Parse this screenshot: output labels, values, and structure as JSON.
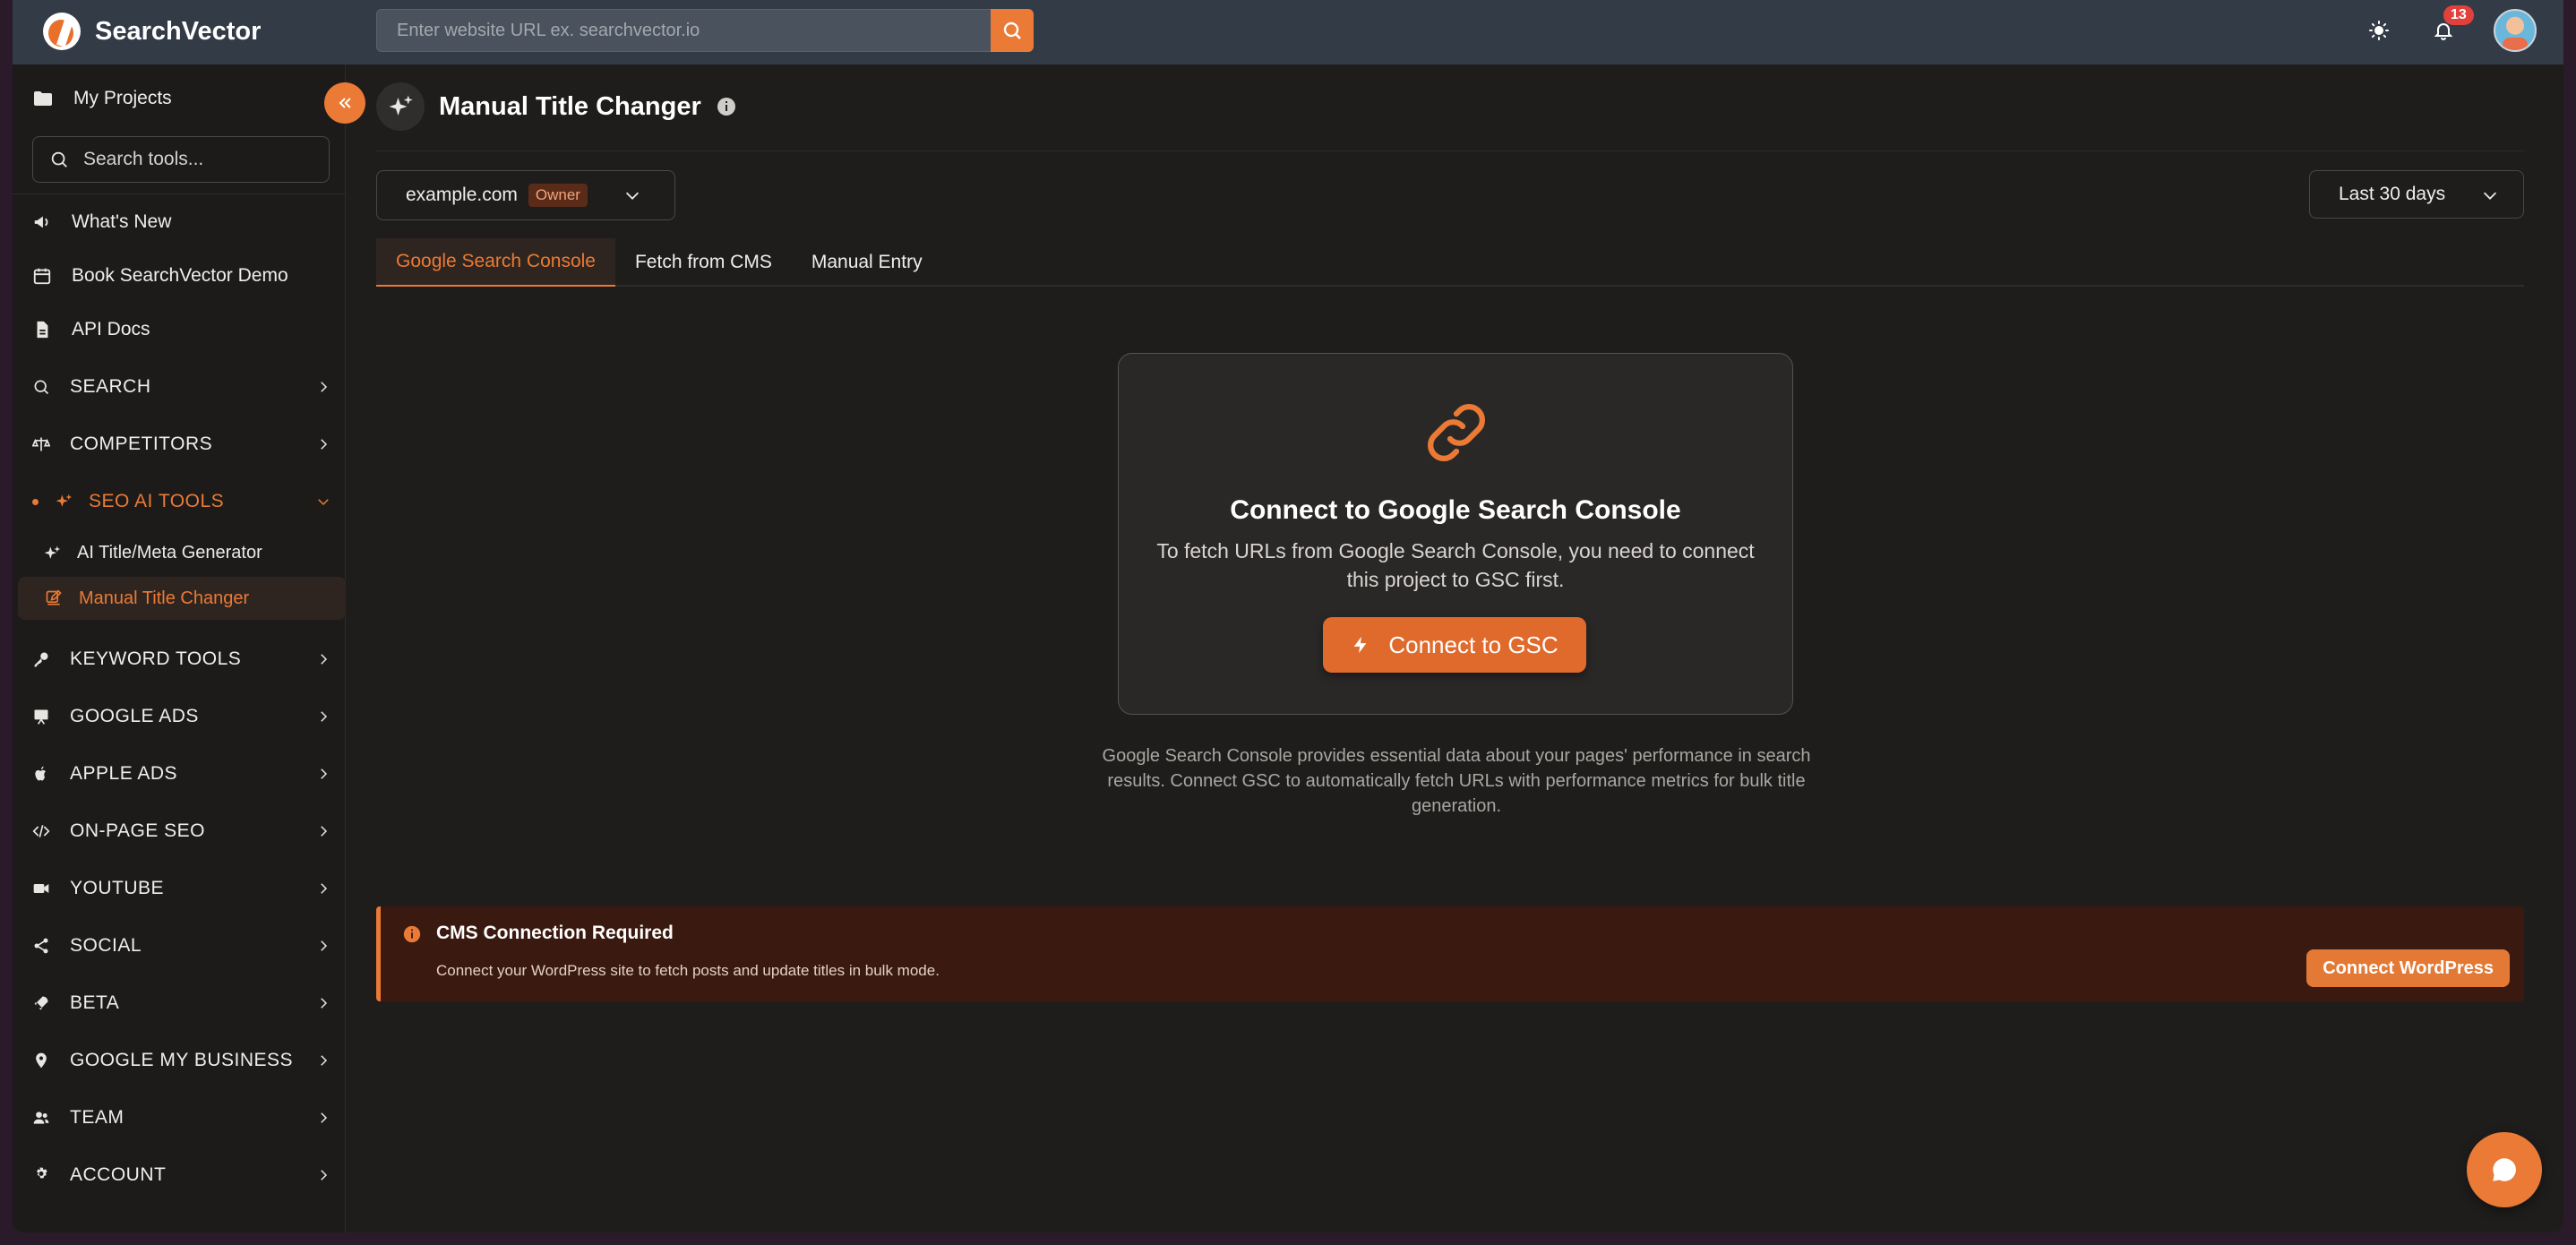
{
  "app": {
    "name": "SearchVector",
    "url_placeholder": "Enter website URL ex. searchvector.io",
    "notification_count": "13"
  },
  "colors": {
    "accent": "#ea7a35",
    "topbar": "#333b47",
    "background": "#1e1d1c",
    "warning_bg": "#3a1a10"
  },
  "sidebar": {
    "my_projects": "My Projects",
    "search_placeholder": "Search tools...",
    "links": [
      {
        "label": "What's New",
        "icon": "megaphone-icon"
      },
      {
        "label": "Book SearchVector Demo",
        "icon": "calendar-icon"
      },
      {
        "label": "API Docs",
        "icon": "document-icon"
      }
    ],
    "sections": [
      {
        "label": "SEARCH",
        "icon": "search-icon"
      },
      {
        "label": "COMPETITORS",
        "icon": "scale-icon"
      },
      {
        "label": "SEO AI TOOLS",
        "icon": "sparkles-icon",
        "expanded": true
      },
      {
        "label": "KEYWORD TOOLS",
        "icon": "key-icon"
      },
      {
        "label": "GOOGLE ADS",
        "icon": "presentation-icon"
      },
      {
        "label": "APPLE ADS",
        "icon": "apple-icon"
      },
      {
        "label": "ON-PAGE SEO",
        "icon": "code-icon"
      },
      {
        "label": "YOUTUBE",
        "icon": "video-icon"
      },
      {
        "label": "SOCIAL",
        "icon": "share-icon"
      },
      {
        "label": "BETA",
        "icon": "rocket-icon"
      },
      {
        "label": "GOOGLE MY BUSINESS",
        "icon": "map-pin-icon"
      },
      {
        "label": "TEAM",
        "icon": "users-icon"
      },
      {
        "label": "ACCOUNT",
        "icon": "gear-icon"
      }
    ],
    "sub_items": [
      {
        "label": "AI Title/Meta Generator",
        "icon": "sparkles-icon"
      },
      {
        "label": "Manual Title Changer",
        "icon": "edit-icon",
        "active": true
      }
    ]
  },
  "page": {
    "title": "Manual Title Changer",
    "project": {
      "name": "example.com",
      "role": "Owner"
    },
    "date_range": "Last 30 days",
    "tabs": [
      "Google Search Console",
      "Fetch from CMS",
      "Manual Entry"
    ],
    "active_tab": "Google Search Console"
  },
  "gsc_card": {
    "title": "Connect to Google Search Console",
    "description": "To fetch URLs from Google Search Console, you need to connect this project to GSC first.",
    "button": "Connect to GSC",
    "note": "Google Search Console provides essential data about your pages' performance in search results. Connect GSC to automatically fetch URLs with performance metrics for bulk title generation."
  },
  "cms_notice": {
    "title": "CMS Connection Required",
    "description": "Connect your WordPress site to fetch posts and update titles in bulk mode.",
    "button": "Connect WordPress"
  }
}
